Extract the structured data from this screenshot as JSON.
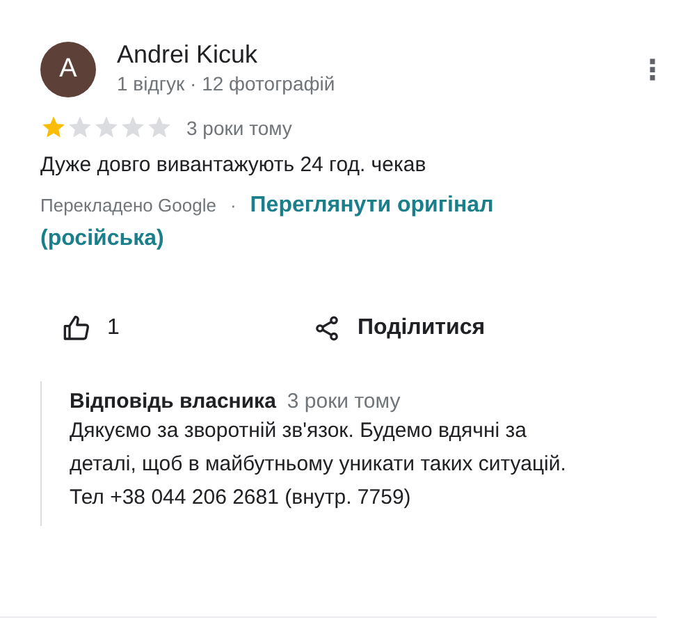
{
  "review": {
    "avatar_letter": "A",
    "author": "Andrei Kicuk",
    "author_meta": "1 відгук · 12 фотографій",
    "more_menu": "⋮",
    "stars": 1,
    "date": "3 роки тому",
    "text": "Дуже довго вивантажують 24 год. чекав",
    "translated_by": "Перекладено Google",
    "separator": "·",
    "original_link_lines": [
      "Переглянути оригінал",
      "(російська)"
    ]
  },
  "actions": {
    "likes": "1",
    "share": "Поділитися"
  },
  "owner_reply": {
    "title": "Відповідь власника",
    "date": "3 роки тому",
    "text": "Дякуємо за зворотній зв'язок. Будемо вдячні за деталі, щоб в майбутньому уникати таких ситуацій.   Тел +38 044 206 2681 (внутр. 7759)"
  }
}
